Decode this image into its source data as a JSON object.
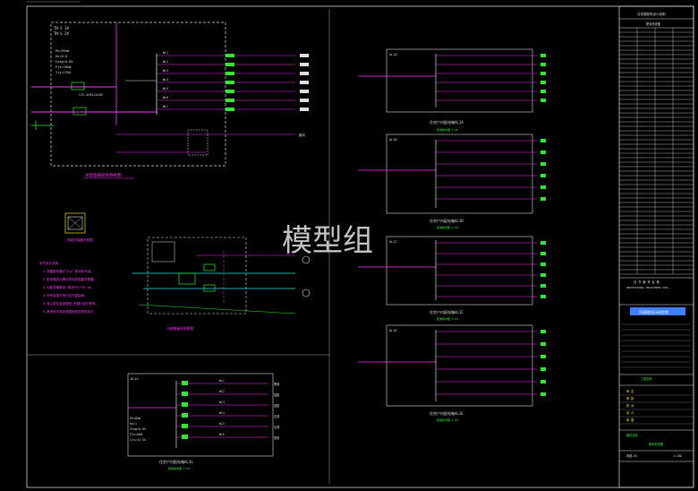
{
  "watermark": "模型组",
  "panels": {
    "main": {
      "caption": "总配电箱接线系统图",
      "top_label_1": "TN-S 1#",
      "top_label_2": "TN-S 2#",
      "params": [
        "Pe=95kW",
        "Kx=0.8",
        "Cosφ=0.85",
        "Pjs=76kW",
        "Ijs=135A"
      ],
      "incoming": "YJV-4x95+1x50",
      "branches": [
        "WL1",
        "WL2",
        "WL3",
        "WL4",
        "WL5",
        "WL6",
        "WL7"
      ],
      "spare": "备用"
    },
    "small_box": {
      "caption": "电缆分接箱大样图"
    },
    "notes": {
      "title": "电气设计说明:",
      "lines": [
        "1.本图配电箱尺寸以厂家实际为准。",
        "2.配电箱内元器件按系统图要求配置。",
        "3.电缆穿管敷设,埋深不小于0.7m。",
        "4.所有金属外壳均应可靠接地。",
        "5.施工前应复核图纸,有疑问及时联系。",
        "6.其他未尽事宜按国家相关规范执行。"
      ]
    },
    "meter": {
      "caption": "计量箱接线系统图"
    },
    "left_bottom": {
      "title": "AL1G",
      "caption": "住宅户内配电箱AL1G",
      "subcaption": "配电箱详图 1:50"
    },
    "right_boxes": [
      {
        "title": "AL1A",
        "caption": "住宅户内配电箱AL1A",
        "subcaption": "配电箱详图 1:50"
      },
      {
        "title": "AL1B",
        "caption": "住宅户内配电箱AL1B",
        "subcaption": "配电箱详图 1:50"
      },
      {
        "title": "AL1C",
        "caption": "住宅户内配电箱AL1C",
        "subcaption": "配电箱详图 1:50"
      },
      {
        "title": "AL1E",
        "caption": "住宅户内配电箱AL1E",
        "subcaption": "配电箱详图 1:50"
      }
    ],
    "box_params": [
      "Pe=8kW",
      "Kx=1",
      "Cosφ=0.85",
      "Pjs=8kW",
      "Ijs=14.3A"
    ],
    "box_feeds": [
      "WL1",
      "WL2",
      "WL3",
      "WL4",
      "WL5",
      "WL6"
    ],
    "box_loads": [
      "照明",
      "插座",
      "插座",
      "空调",
      "空调",
      "厨房"
    ]
  },
  "title_block": {
    "header": "住宅楼配电设计说明",
    "sub": "配电系统图",
    "cert_1": "证 书 编 号 合 格",
    "cert_2": "PROFESSIONAL REGISTERED SEAL",
    "company": "XX建筑设计研究院",
    "project_label": "工程名称",
    "drawing_label": "图纸名称",
    "drawing_name": "配电系统图",
    "rows": [
      "审 定",
      "审 核",
      "校 对",
      "设 计",
      "制 图"
    ],
    "number": "电施-05",
    "scale": "1:100"
  },
  "colors": {
    "bg": "#000000",
    "line": "#e8e8e8",
    "accent_magenta": "#ff30ff",
    "accent_green": "#30e830",
    "accent_cyan": "#30e0e0",
    "accent_yellow": "#f0e030",
    "accent_blue": "#4080ff"
  }
}
